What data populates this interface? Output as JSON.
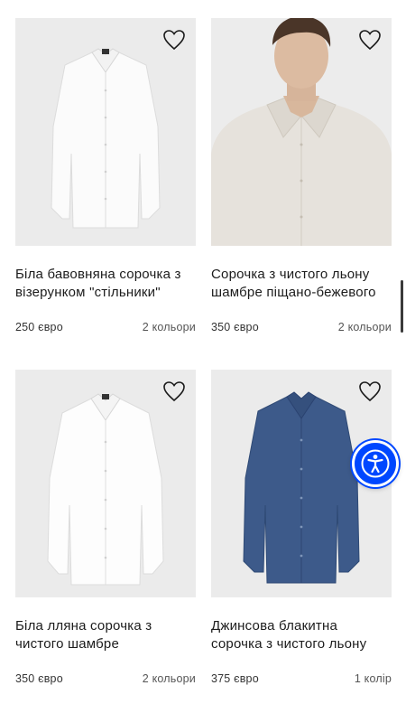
{
  "products": [
    {
      "title": "Біла бавовняна сорочка з візерунком \"стільники\"",
      "price": "250 євро",
      "colors": "2 кольори",
      "image": "white-shirt-flat"
    },
    {
      "title": "Сорочка з чистого льону шамбре піщано-бежевого кольору",
      "price": "350 євро",
      "colors": "2 кольори",
      "image": "beige-shirt-model"
    },
    {
      "title": "Біла лляна сорочка з чистого шамбре",
      "price": "350 євро",
      "colors": "2 кольори",
      "image": "white-linen-shirt-flat"
    },
    {
      "title": "Джинсова блакитна сорочка з чистого льону",
      "price": "375 євро",
      "colors": "1 колір",
      "image": "denim-shirt-flat"
    }
  ],
  "icons": {
    "favorite": "heart-outline-icon",
    "accessibility": "accessibility-person-icon"
  },
  "theme": {
    "image_background": "#ebebeb",
    "accessibility_button": "#0047ff",
    "denim": "#3d5a8a",
    "beige": "#e6e2dc"
  }
}
